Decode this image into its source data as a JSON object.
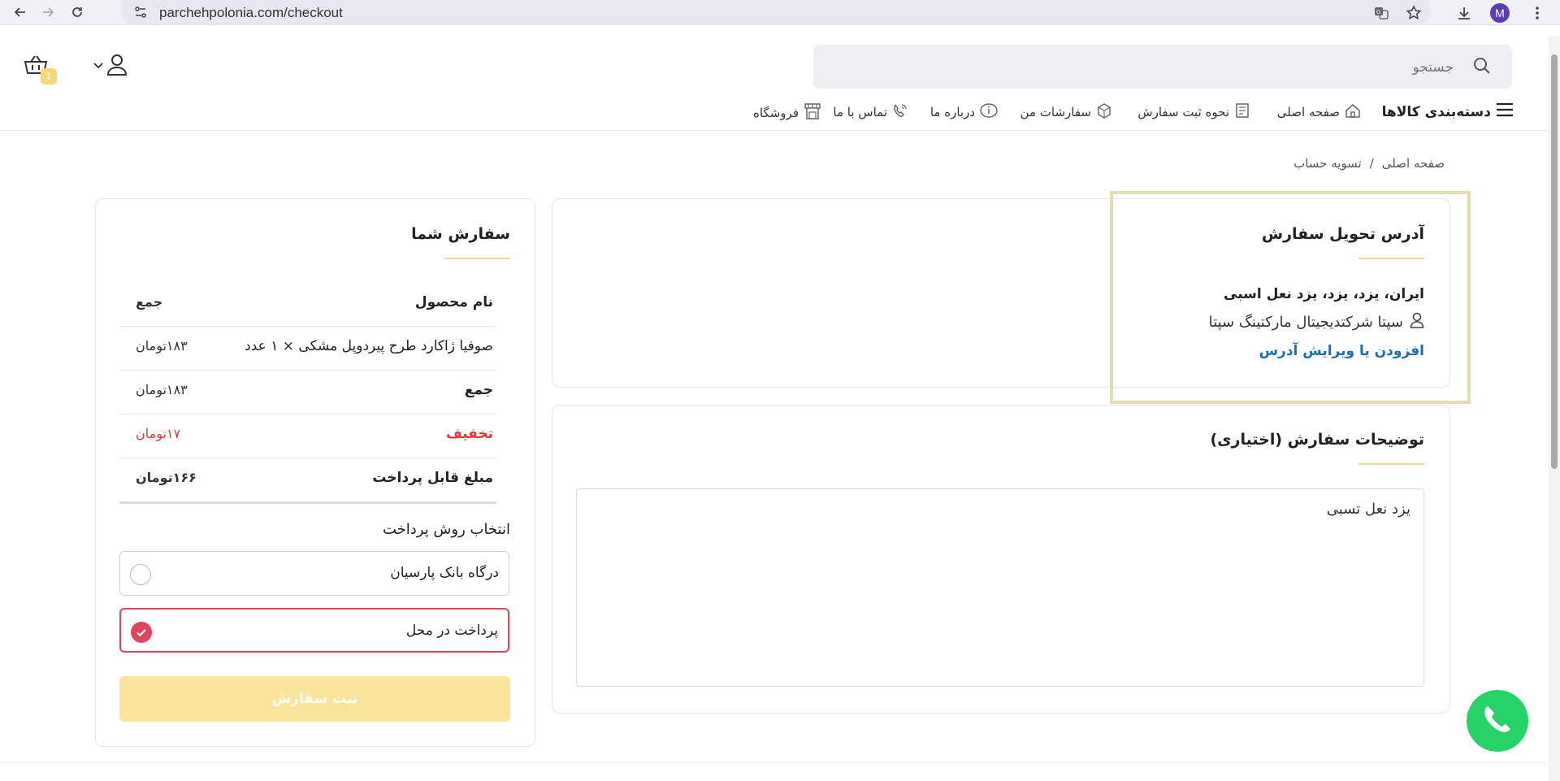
{
  "browser": {
    "url": "parchehpolonia.com/checkout",
    "profile_initial": "M"
  },
  "header": {
    "search_placeholder": "جستجو",
    "cart_count": "1"
  },
  "nav": {
    "categories": "دسته‌بندی کالاها",
    "home": "صفحه اصلی",
    "how_to_order": "نحوه ثبت سفارش",
    "my_orders": "سفارشات من",
    "about": "درباره ما",
    "contact": "تماس با ما",
    "shop": "فروشگاه"
  },
  "breadcrumb": {
    "home": "صفحه اصلی",
    "separator": "/",
    "current": "تسویه حساب"
  },
  "order": {
    "title": "سفارش شما",
    "header": {
      "product": "نام محصول",
      "total": "جمع"
    },
    "item": {
      "name": "صوفیا ژاکارد طرح پیردوپل مشکی × ۱ عدد",
      "price": "۱۸۳تومان"
    },
    "subtotal": {
      "label": "جمع",
      "value": "۱۸۳تومان"
    },
    "discount": {
      "label": "تخفیف",
      "value": "۱۷تومان"
    },
    "payable": {
      "label": "مبلغ قابل پرداخت",
      "value": "۱۶۶تومان"
    }
  },
  "payment": {
    "title": "انتخاب روش پرداخت",
    "options": [
      {
        "label": "درگاه بانک پارسیان",
        "selected": false
      },
      {
        "label": "پرداخت در محل",
        "selected": true
      }
    ],
    "submit_label": "ثبت سفارش"
  },
  "address": {
    "title": "آدرس تحویل سفارش",
    "line": "ایران، یزد، یزد، یزد نعل اسبی",
    "recipient": "سپتا شرکتدیجیتال مارکتینگ سپتا",
    "edit_link": "افزودن یا ویرایش آدرس"
  },
  "notes": {
    "title": "توضیحات سفارش (اختیاری)",
    "value": "یزد نعل تسبی"
  },
  "colors": {
    "accent_yellow": "#fbe59a",
    "selected_red": "#e0445a",
    "discount_red": "#e03a3a",
    "link_blue": "#1a6fb0",
    "whatsapp_green": "#25d366"
  }
}
